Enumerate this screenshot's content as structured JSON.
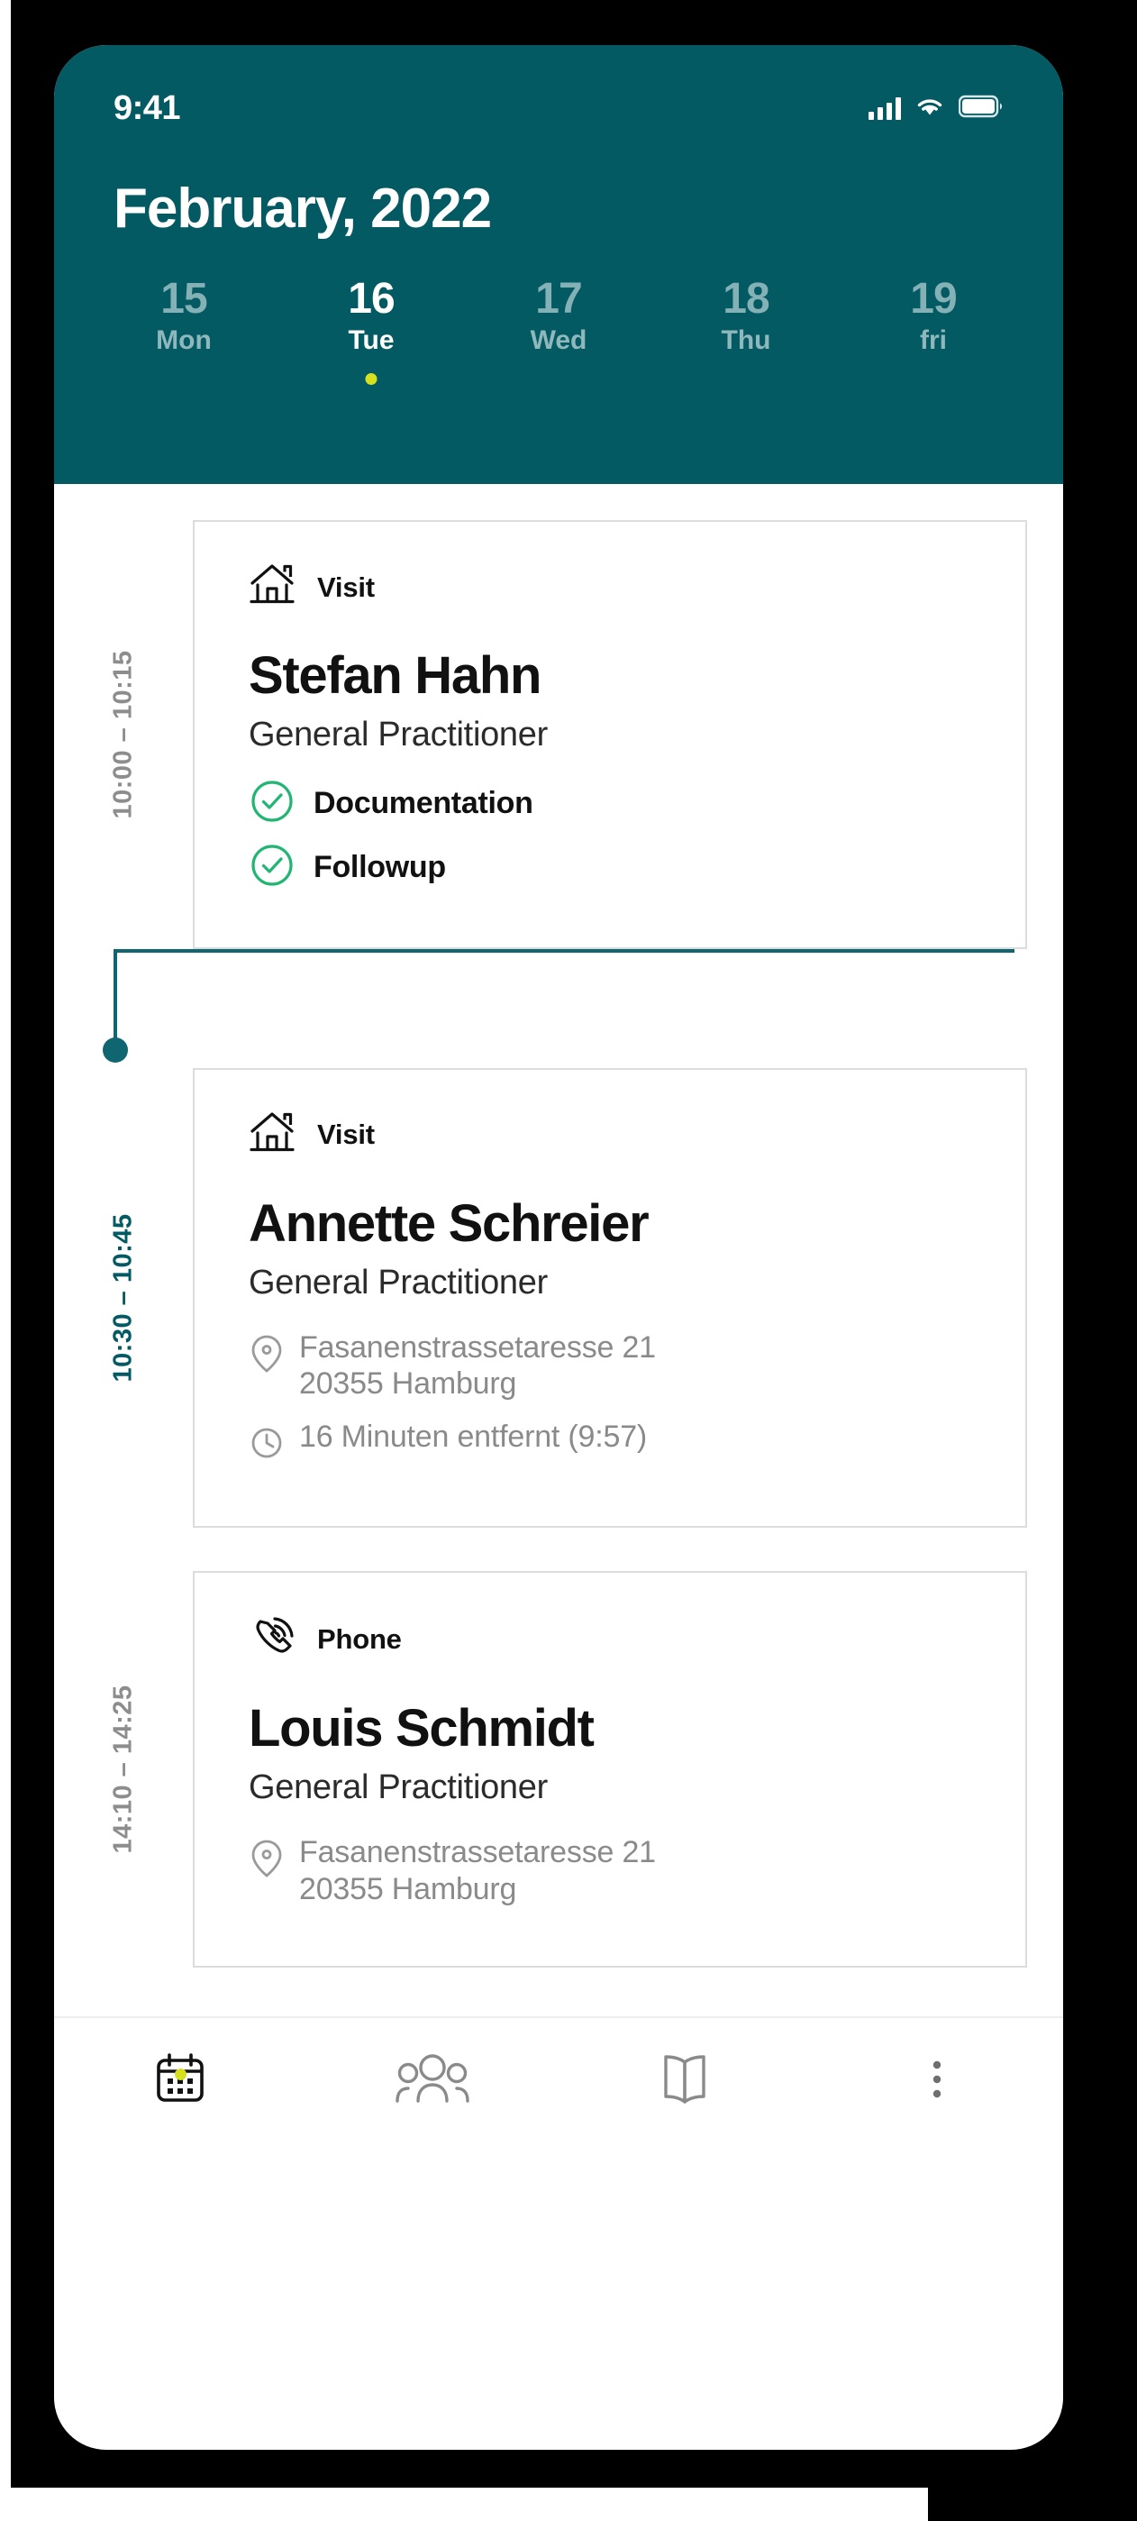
{
  "theme": {
    "header_teal": "#035A63",
    "accent_yellow": "#D7E01E",
    "timeline_teal": "#106670",
    "check_green": "#22B573",
    "muted_gray": "#8A8A8A"
  },
  "status_bar": {
    "time": "9:41",
    "signal_icon": "cellular-signal-icon",
    "wifi_icon": "wifi-icon",
    "battery_icon": "battery-icon"
  },
  "header": {
    "month_title": "February, 2022"
  },
  "days": [
    {
      "num": "15",
      "name": "Mon",
      "active": false,
      "has_dot": false
    },
    {
      "num": "16",
      "name": "Tue",
      "active": true,
      "has_dot": true
    },
    {
      "num": "17",
      "name": "Wed",
      "active": false,
      "has_dot": false
    },
    {
      "num": "18",
      "name": "Thu",
      "active": false,
      "has_dot": false
    },
    {
      "num": "19",
      "name": "fri",
      "active": false,
      "has_dot": false
    }
  ],
  "appointments": [
    {
      "time_range": "10:00  –  10:15",
      "current": false,
      "type_icon": "home-icon",
      "type_label": "Visit",
      "patient_name": "Stefan Hahn",
      "role": "General Practitioner",
      "tasks": [
        {
          "icon": "check-circle-icon",
          "label": "Documentation"
        },
        {
          "icon": "check-circle-icon",
          "label": "Followup"
        }
      ],
      "meta": []
    },
    {
      "time_range": "10:30  –  10:45",
      "current": true,
      "type_icon": "home-icon",
      "type_label": "Visit",
      "patient_name": "Annette Schreier",
      "role": "General Practitioner",
      "tasks": [],
      "meta": [
        {
          "icon": "location-pin-icon",
          "text": "Fasanenstrassetaresse 21\n20355 Hamburg"
        },
        {
          "icon": "clock-icon",
          "text": "16 Minuten entfernt (9:57)"
        }
      ]
    },
    {
      "time_range": "14:10  –  14:25",
      "current": false,
      "type_icon": "phone-icon",
      "type_label": "Phone",
      "patient_name": "Louis Schmidt",
      "role": "General Practitioner",
      "tasks": [],
      "meta": [
        {
          "icon": "location-pin-icon",
          "text": "Fasanenstrassetaresse 21\n20355 Hamburg"
        }
      ]
    }
  ],
  "bottom_nav": [
    {
      "icon": "calendar-icon",
      "active": true
    },
    {
      "icon": "people-icon",
      "active": false
    },
    {
      "icon": "book-icon",
      "active": false
    },
    {
      "icon": "more-vertical-icon",
      "active": false
    }
  ]
}
